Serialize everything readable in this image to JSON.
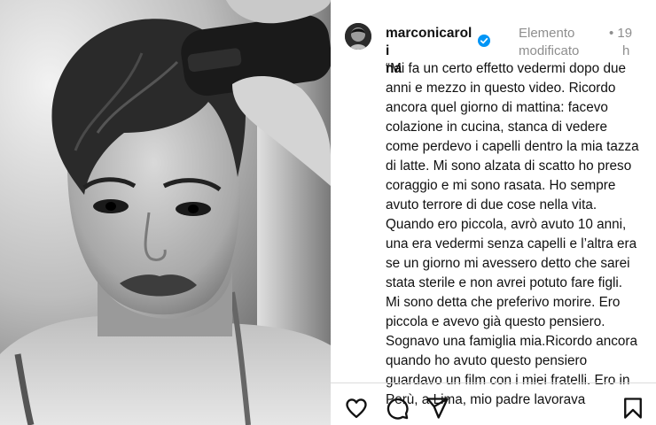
{
  "post": {
    "username_lines": [
      "marconicaroli",
      "na"
    ],
    "edited_lines": [
      "Elemento",
      "modificato"
    ],
    "time_lines": [
      "• 19",
      "h"
    ],
    "caption_lines": [
      "“Mi fa un certo effetto vedermi dopo due",
      "anni e mezzo in questo video. Ricordo",
      "ancora quel giorno di mattina: facevo",
      "colazione in cucina, stanca di vedere",
      "come perdevo i capelli dentro la mia tazza",
      "di latte. Mi sono alzata di scatto ho preso",
      "coraggio e mi sono rasata. Ho sempre",
      "avuto terrore di due cose nella vita.",
      "Quando ero piccola, avrò avuto 10 anni,",
      "una era vedermi senza capelli e l’altra era",
      "se un giorno mi avessero detto che sarei",
      "stata sterile e non avrei potuto fare figli.",
      "Mi sono detta che preferivo morire. Ero",
      "piccola e avevo già questo pensiero.",
      "Sognavo una famiglia mia.Ricordo ancora",
      "quando ho avuto questo pensiero",
      "guardavo un film con i miei fratelli. Ero in",
      "Perù, a Lima, mio padre lavorava"
    ]
  },
  "icons": {
    "like": "heart-icon",
    "comment": "comment-icon",
    "share": "share-icon",
    "save": "bookmark-icon",
    "verified": "verified-badge-icon"
  },
  "colors": {
    "verified": "#0095f6",
    "secondary_text": "#8e8e8e",
    "text": "#111111"
  }
}
